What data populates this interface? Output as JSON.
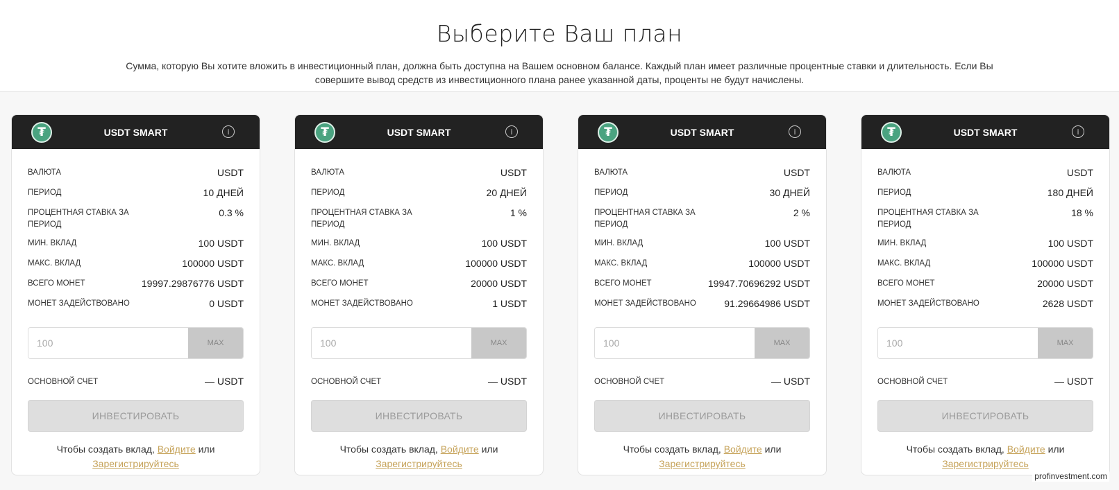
{
  "header": {
    "title": "Выберите Ваш план",
    "description": "Сумма, которую Вы хотите вложить в инвестиционный план, должна быть доступна на Вашем основном балансе. Каждый план имеет различные процентные ставки и длительность. Если Вы совершите вывод средств из инвестиционного плана ранее указанной даты, проценты не будут начислены."
  },
  "labels": {
    "currency": "Валюта",
    "period": "Период",
    "rate": "Процентная ставка за период",
    "min": "Мин. вклад",
    "max_deposit": "Макс. вклад",
    "total": "Всего монет",
    "used": "Монет задействовано",
    "max_button": "MAX",
    "main_account": "Основной счет",
    "invest_button": "Инвестировать",
    "note_prefix": "Чтобы создать вклад,",
    "login_link": "Войдите",
    "note_or": "или",
    "register_link": "Зарегистрируйтесь"
  },
  "plans": [
    {
      "name": "USDT SMART",
      "currency": "USDT",
      "period": "10 ДНЕЙ",
      "rate": "0.3 %",
      "min": "100 USDT",
      "max": "100000 USDT",
      "total": "19997.29876776 USDT",
      "used": "0 USDT",
      "placeholder": "100",
      "balance": "— USDT"
    },
    {
      "name": "USDT SMART",
      "currency": "USDT",
      "period": "20 ДНЕЙ",
      "rate": "1 %",
      "min": "100 USDT",
      "max": "100000 USDT",
      "total": "20000 USDT",
      "used": "1 USDT",
      "placeholder": "100",
      "balance": "— USDT"
    },
    {
      "name": "USDT SMART",
      "currency": "USDT",
      "period": "30 ДНЕЙ",
      "rate": "2 %",
      "min": "100 USDT",
      "max": "100000 USDT",
      "total": "19947.70696292 USDT",
      "used": "91.29664986 USDT",
      "placeholder": "100",
      "balance": "— USDT"
    },
    {
      "name": "USDT SMART",
      "currency": "USDT",
      "period": "180 ДНЕЙ",
      "rate": "18 %",
      "min": "100 USDT",
      "max": "100000 USDT",
      "total": "20000 USDT",
      "used": "2628 USDT",
      "placeholder": "100",
      "balance": "— USDT"
    }
  ],
  "icons": {
    "coin": "tether-icon",
    "info": "info-icon"
  },
  "colors": {
    "header_bg": "#222222",
    "coin": "#4aa380",
    "link": "#c6a35a"
  },
  "watermark": "profinvestment.com"
}
